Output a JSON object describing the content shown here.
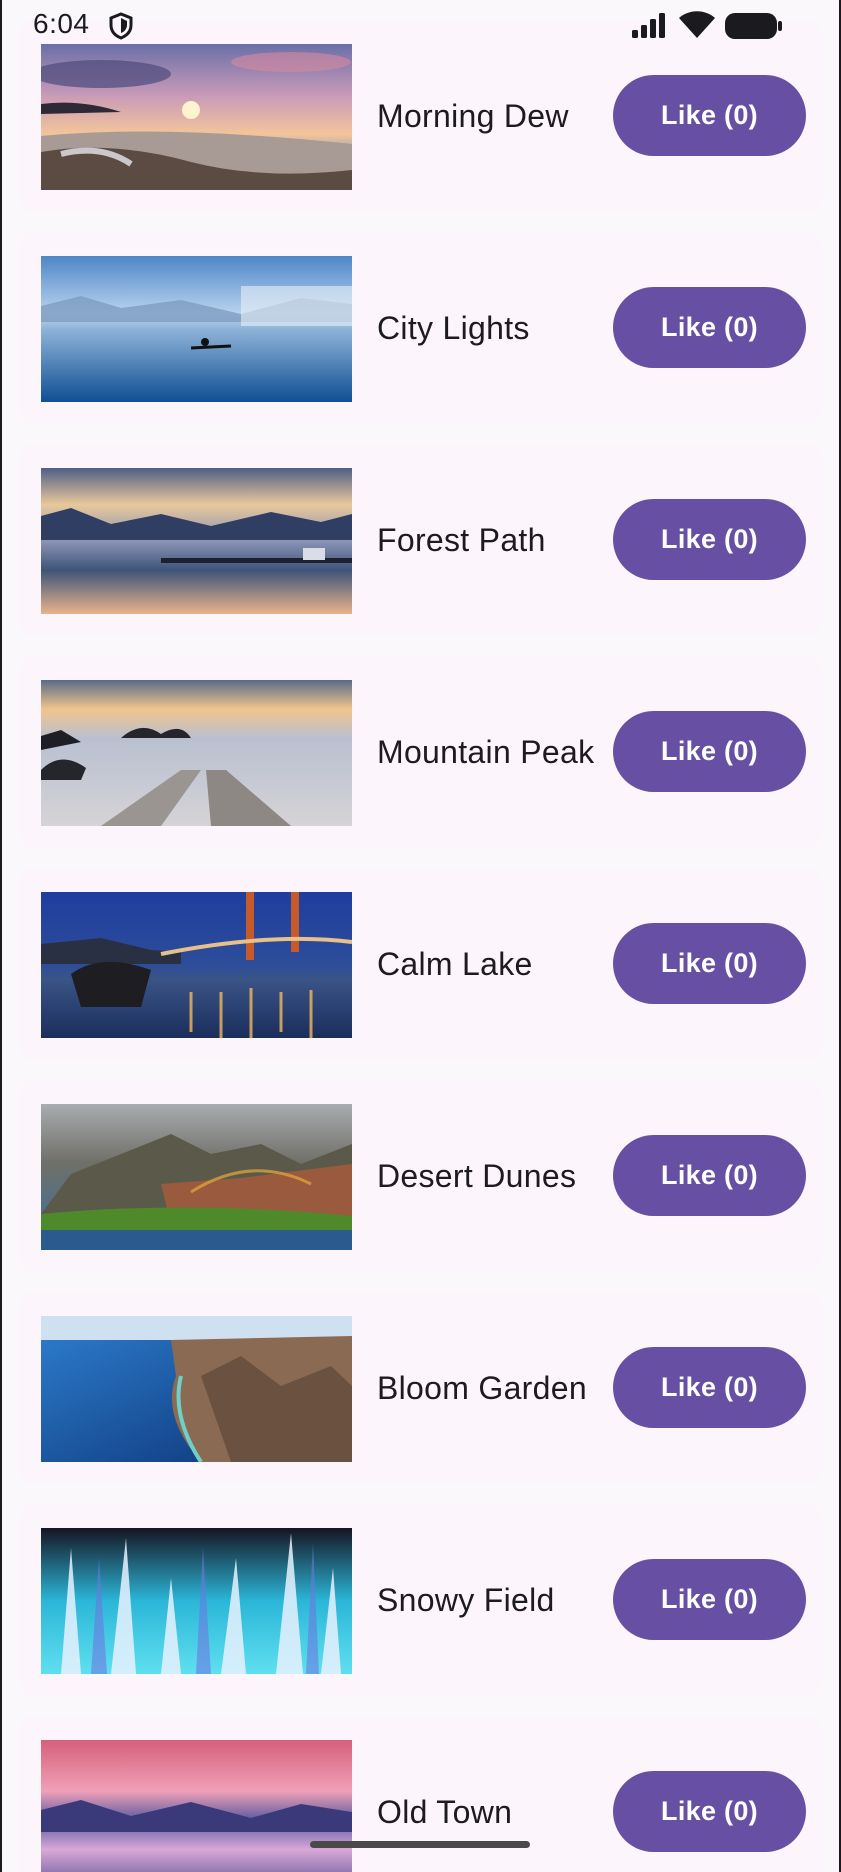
{
  "status_bar": {
    "time": "6:04"
  },
  "items": [
    {
      "title": "Morning Dew",
      "like_label": "Like (0)",
      "likes": 0,
      "scene": "beach-sunset"
    },
    {
      "title": "City Lights",
      "like_label": "Like (0)",
      "likes": 0,
      "scene": "lake-kayak"
    },
    {
      "title": "Forest Path",
      "like_label": "Like (0)",
      "likes": 0,
      "scene": "lake-dusk-boat"
    },
    {
      "title": "Mountain Peak",
      "like_label": "Like (0)",
      "likes": 0,
      "scene": "sea-rocks-pier"
    },
    {
      "title": "Calm Lake",
      "like_label": "Like (0)",
      "likes": 0,
      "scene": "bridge-night"
    },
    {
      "title": "Desert Dunes",
      "like_label": "Like (0)",
      "likes": 0,
      "scene": "cliffs-rainbow"
    },
    {
      "title": "Bloom Garden",
      "like_label": "Like (0)",
      "likes": 0,
      "scene": "coast-aerial"
    },
    {
      "title": "Snowy Field",
      "like_label": "Like (0)",
      "likes": 0,
      "scene": "ice-abstract"
    },
    {
      "title": "Old Town",
      "like_label": "Like (0)",
      "likes": 0,
      "scene": "pink-sky-lake"
    }
  ],
  "colors": {
    "accent": "#6750a4",
    "card_background": "#fcf5fc",
    "page_background": "#fbf8fb",
    "text": "#1d1b20"
  }
}
